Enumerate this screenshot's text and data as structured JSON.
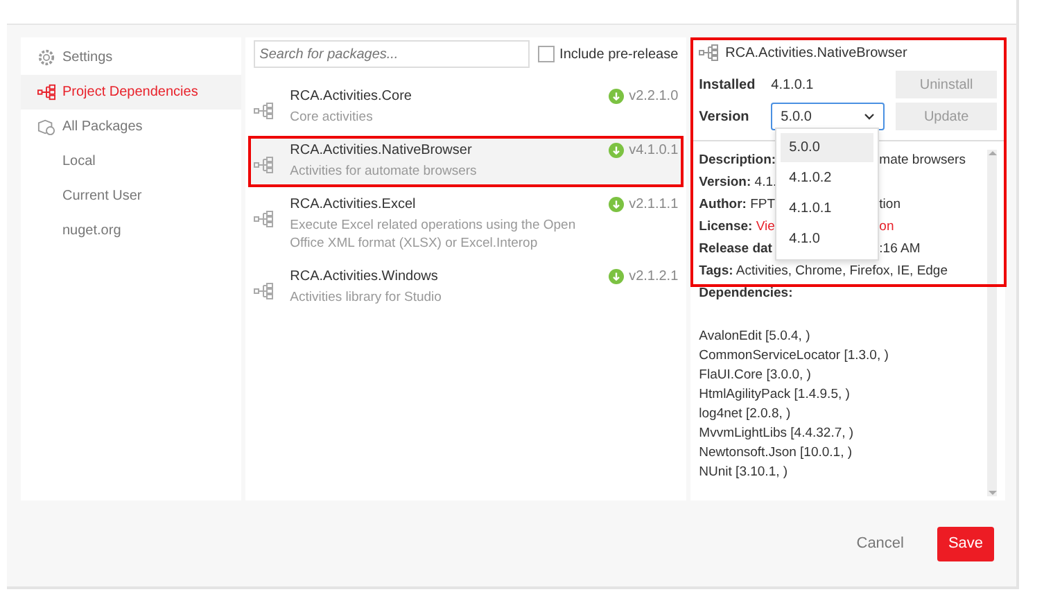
{
  "sidebar": {
    "items": [
      {
        "label": "Settings",
        "selected": false
      },
      {
        "label": "Project Dependencies",
        "selected": true
      },
      {
        "label": "All Packages",
        "selected": false
      },
      {
        "label": "Local",
        "selected": false
      },
      {
        "label": "Current User",
        "selected": false
      },
      {
        "label": "nuget.org",
        "selected": false
      }
    ]
  },
  "search": {
    "placeholder": "Search for packages..."
  },
  "prerelease": {
    "label": "Include pre-release",
    "checked": false
  },
  "packages": [
    {
      "name": "RCA.Activities.Core",
      "description": "Core activities",
      "version": "v2.2.1.0",
      "selected": false,
      "highlighted": false
    },
    {
      "name": "RCA.Activities.NativeBrowser",
      "description": "Activities for automate browsers",
      "version": "v4.1.0.1",
      "selected": true,
      "highlighted": true
    },
    {
      "name": "RCA.Activities.Excel",
      "description": "Execute Excel related operations using the Open Office XML format (XLSX) or Excel.Interop",
      "version": "v2.1.1.1",
      "selected": false,
      "highlighted": false
    },
    {
      "name": "RCA.Activities.Windows",
      "description": "Activities library for Studio",
      "version": "v2.1.2.1",
      "selected": false,
      "highlighted": false
    }
  ],
  "details": {
    "highlighted": true,
    "title": "RCA.Activities.NativeBrowser",
    "installed_label": "Installed",
    "installed": "4.1.0.1",
    "uninstall": "Uninstall",
    "version_label": "Version",
    "version": "5.0.0",
    "update": "Update",
    "version_options": [
      {
        "label": "5.0.0",
        "selected": true
      },
      {
        "label": "4.1.0.2",
        "selected": false
      },
      {
        "label": "4.1.0.1",
        "selected": false
      },
      {
        "label": "4.1.0",
        "selected": false
      }
    ],
    "rows": [
      {
        "label": "Description:",
        "value": "",
        "tail": "mate browsers",
        "kind": "text"
      },
      {
        "label": "Version:",
        "value": "4.1.",
        "tail": "",
        "kind": "text"
      },
      {
        "label": "Author:",
        "value": "FPT",
        "tail": "tion",
        "kind": "text"
      },
      {
        "label": "License:",
        "value": "Vie",
        "tail": "on",
        "kind": "link"
      },
      {
        "label": "Release dat",
        "value": "",
        "tail": ":16 AM",
        "kind": "text"
      },
      {
        "label": "Tags:",
        "value": "Activities, Chrome, Firefox, IE, Edge",
        "tail": "",
        "kind": "text"
      }
    ],
    "dependencies_label": "Dependencies:",
    "dependencies": [
      "AvalonEdit [5.0.4, )",
      "CommonServiceLocator [1.3.0, )",
      "FlaUI.Core [3.0.0, )",
      "HtmlAgilityPack [1.4.9.5, )",
      "log4net [2.0.8, )",
      "MvvmLightLibs [4.4.32.7, )",
      "Newtonsoft.Json [10.0.1, )",
      "NUnit [3.10.1, )"
    ]
  },
  "buttons": {
    "cancel": "Cancel",
    "save": "Save"
  }
}
